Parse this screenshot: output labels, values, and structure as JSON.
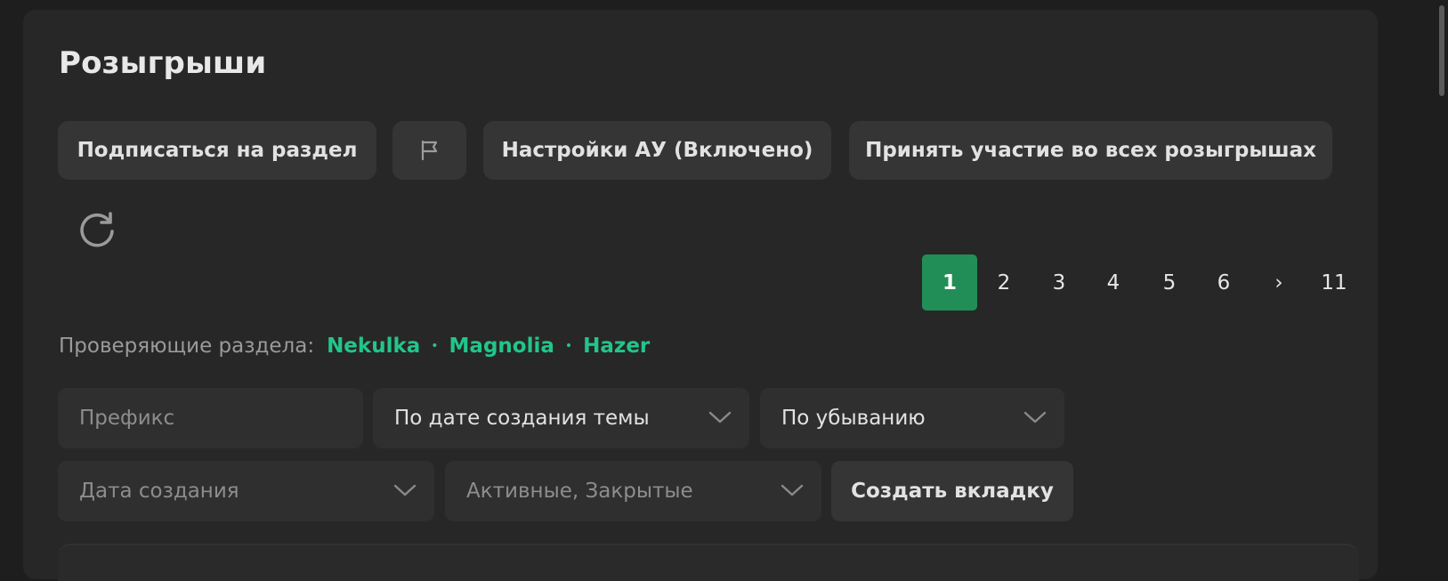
{
  "header": {
    "title": "Розыгрыши"
  },
  "actions": {
    "subscribe_label": "Подписаться на раздел",
    "flag_icon": "flag-icon",
    "settings_label": "Настройки АУ (Включено)",
    "join_all_label": "Принять участие во всех розыгрышах",
    "refresh_icon": "refresh-icon"
  },
  "pagination": {
    "current": 1,
    "pages": [
      "1",
      "2",
      "3",
      "4",
      "5",
      "6",
      "›",
      "11"
    ],
    "accent": "#228e57"
  },
  "reviewers": {
    "label": "Проверяющие раздела:",
    "names": [
      "Nekulka",
      "Magnolia",
      "Hazer"
    ],
    "separator": "•",
    "color": "#22c58a"
  },
  "filters": {
    "prefix_placeholder": "Префикс",
    "sort_value": "По дате создания темы",
    "order_value": "По убыванию",
    "date_placeholder": "Дата создания",
    "status_placeholder": "Активные, Закрытые",
    "create_tab_label": "Создать вкладку"
  }
}
